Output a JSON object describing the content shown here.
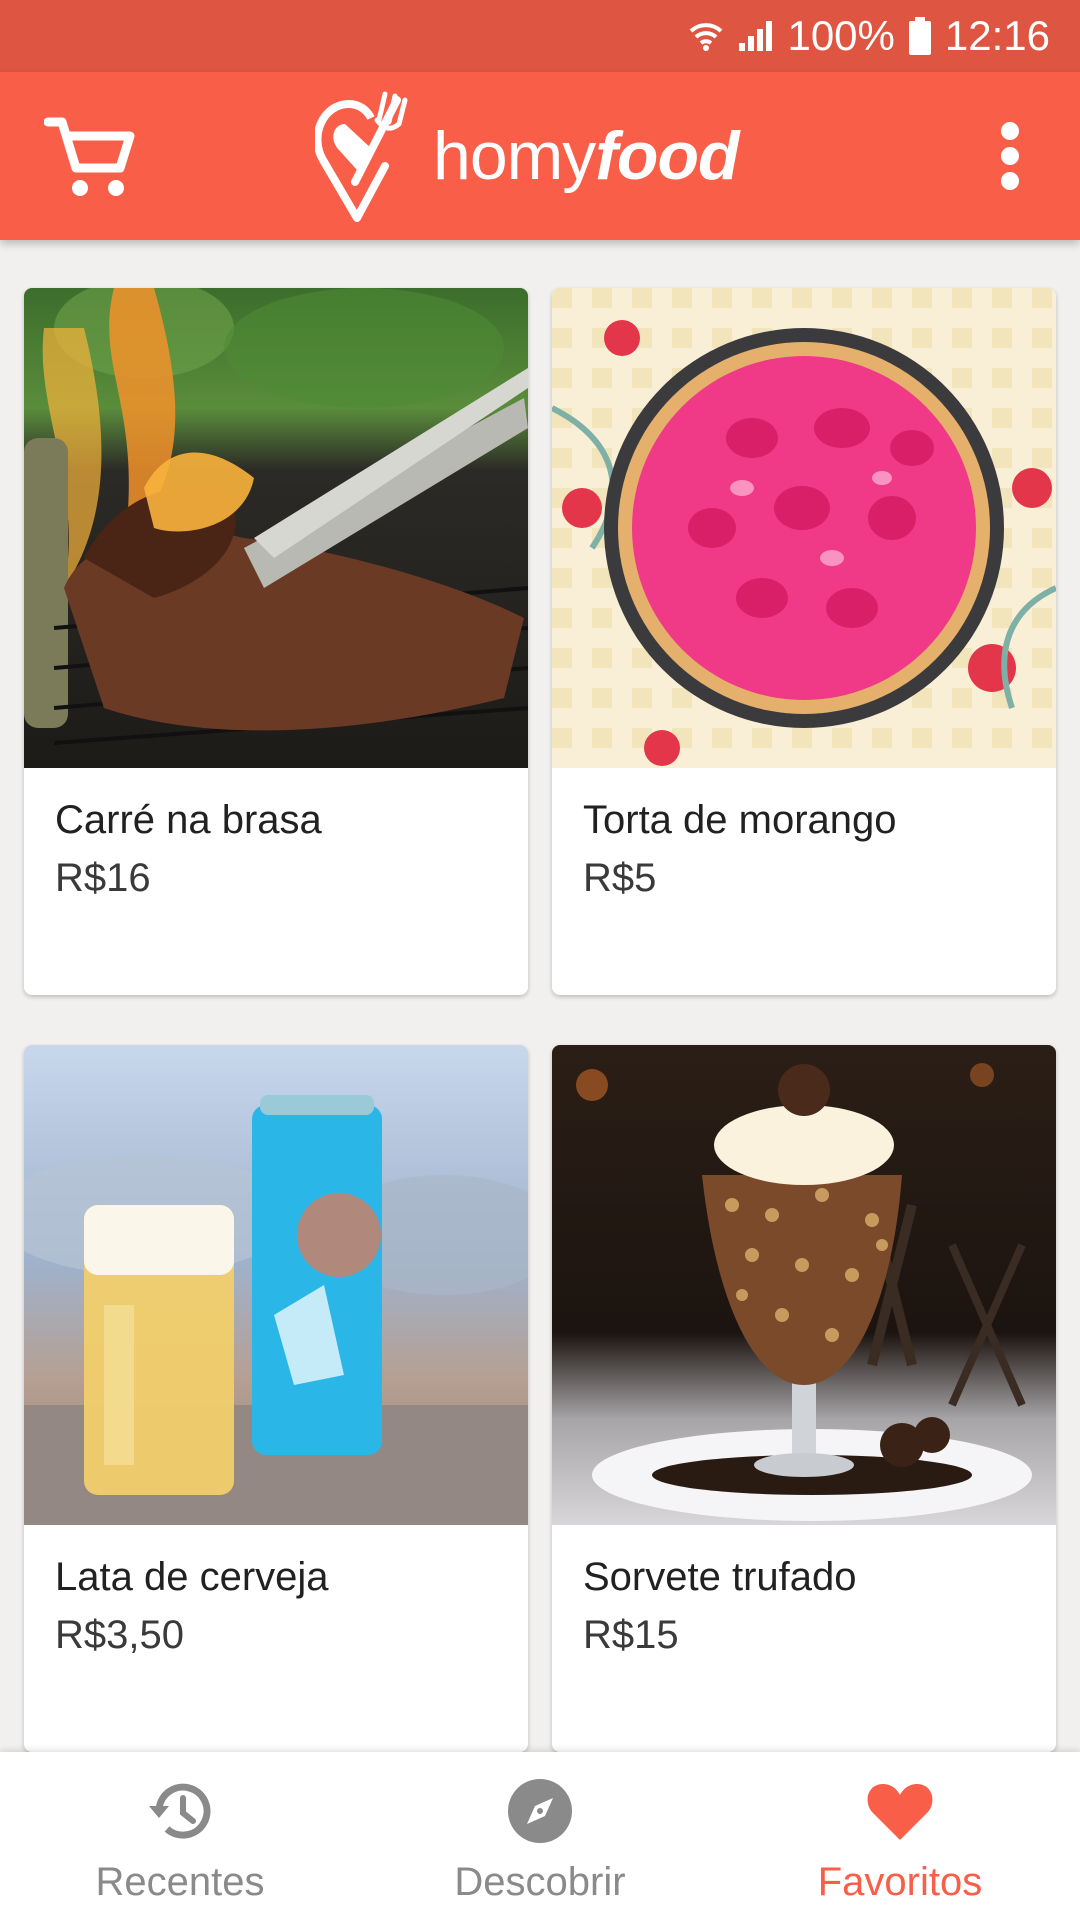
{
  "status_bar": {
    "battery": "100%",
    "time": "12:16"
  },
  "app_bar": {
    "logo_light": "homy",
    "logo_bold": "food"
  },
  "products": [
    {
      "title": "Carré na brasa",
      "price": "R$16"
    },
    {
      "title": "Torta de morango",
      "price": "R$5"
    },
    {
      "title": "Lata de cerveja",
      "price": "R$3,50"
    },
    {
      "title": "Sorvete trufado",
      "price": "R$15"
    }
  ],
  "bottom_nav": {
    "items": [
      {
        "label": "Recentes",
        "icon": "history-icon"
      },
      {
        "label": "Descobrir",
        "icon": "compass-icon"
      },
      {
        "label": "Favoritos",
        "icon": "heart-icon",
        "active": true
      }
    ]
  },
  "colors": {
    "status_bar": "#de5641",
    "app_bar": "#f85e48",
    "accent": "#f85e48"
  }
}
